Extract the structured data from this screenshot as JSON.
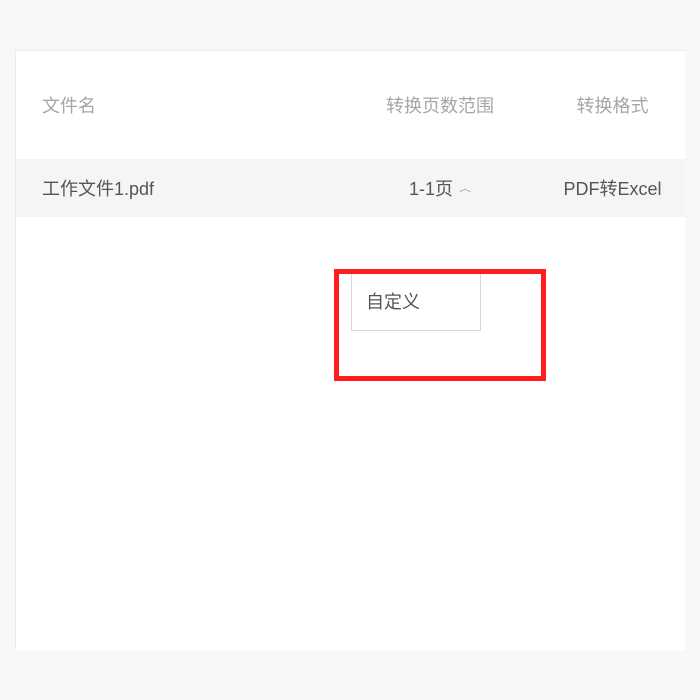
{
  "columns": {
    "filename": "文件名",
    "range": "转换页数范围",
    "format": "转换格式"
  },
  "row": {
    "filename": "工作文件1.pdf",
    "range": "1-1页",
    "format": "PDF转Excel"
  },
  "dropdown": {
    "custom": "自定义"
  }
}
